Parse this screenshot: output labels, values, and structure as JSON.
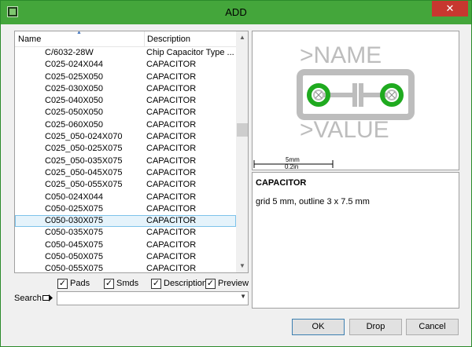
{
  "window": {
    "title": "ADD",
    "close_label": "✕"
  },
  "list": {
    "header_name": "Name",
    "header_desc": "Description",
    "rows": [
      {
        "name": "C/6032-28W",
        "desc": "Chip Capacitor Type ..."
      },
      {
        "name": "C025-024X044",
        "desc": "CAPACITOR"
      },
      {
        "name": "C025-025X050",
        "desc": "CAPACITOR"
      },
      {
        "name": "C025-030X050",
        "desc": "CAPACITOR"
      },
      {
        "name": "C025-040X050",
        "desc": "CAPACITOR"
      },
      {
        "name": "C025-050X050",
        "desc": "CAPACITOR"
      },
      {
        "name": "C025-060X050",
        "desc": "CAPACITOR"
      },
      {
        "name": "C025_050-024X070",
        "desc": "CAPACITOR"
      },
      {
        "name": "C025_050-025X075",
        "desc": "CAPACITOR"
      },
      {
        "name": "C025_050-035X075",
        "desc": "CAPACITOR"
      },
      {
        "name": "C025_050-045X075",
        "desc": "CAPACITOR"
      },
      {
        "name": "C025_050-055X075",
        "desc": "CAPACITOR"
      },
      {
        "name": "C050-024X044",
        "desc": "CAPACITOR"
      },
      {
        "name": "C050-025X075",
        "desc": "CAPACITOR"
      },
      {
        "name": "C050-030X075",
        "desc": "CAPACITOR",
        "selected": true
      },
      {
        "name": "C050-035X075",
        "desc": "CAPACITOR"
      },
      {
        "name": "C050-045X075",
        "desc": "CAPACITOR"
      },
      {
        "name": "C050-050X075",
        "desc": "CAPACITOR"
      },
      {
        "name": "C050-055X075",
        "desc": "CAPACITOR"
      }
    ]
  },
  "options": {
    "pads": "Pads",
    "smds": "Smds",
    "description": "Description",
    "preview": "Preview",
    "checkmark": "✓"
  },
  "search": {
    "label": "Search",
    "value": ""
  },
  "preview": {
    "name_text": ">NAME",
    "value_text": ">VALUE",
    "scale_top": "5mm",
    "scale_bottom": "0.2in"
  },
  "details": {
    "title": "CAPACITOR",
    "text": "grid 5 mm, outline 3 x 7.5 mm"
  },
  "buttons": {
    "ok": "OK",
    "drop": "Drop",
    "cancel": "Cancel"
  },
  "colors": {
    "titlebar": "#44a63b",
    "close": "#c7372f",
    "pad_green": "#1faa1f",
    "outline_gray": "#bdbdbd"
  }
}
